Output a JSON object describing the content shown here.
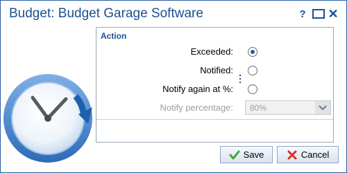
{
  "window": {
    "title": "Budget: Budget Garage Software",
    "help_label": "?"
  },
  "section": {
    "title": "Action"
  },
  "fields": {
    "exceeded_label": "Exceeded:",
    "notified_label": "Notified:",
    "notify_again_label": "Notify again at %:",
    "notify_percentage_label": "Notify percentage:",
    "notify_percentage_value": "80%"
  },
  "selected_option": "Exceeded",
  "buttons": {
    "save_label": "Save",
    "cancel_label": "Cancel"
  },
  "colors": {
    "accent": "#1b4f91",
    "radio_selected": "#1c5fb0",
    "save_check": "#3ea33a",
    "cancel_x": "#d9302b"
  },
  "icons": [
    "clock-icon",
    "help-icon",
    "maximize-icon",
    "close-icon",
    "checkmark-icon",
    "x-icon",
    "chevron-down-icon"
  ]
}
